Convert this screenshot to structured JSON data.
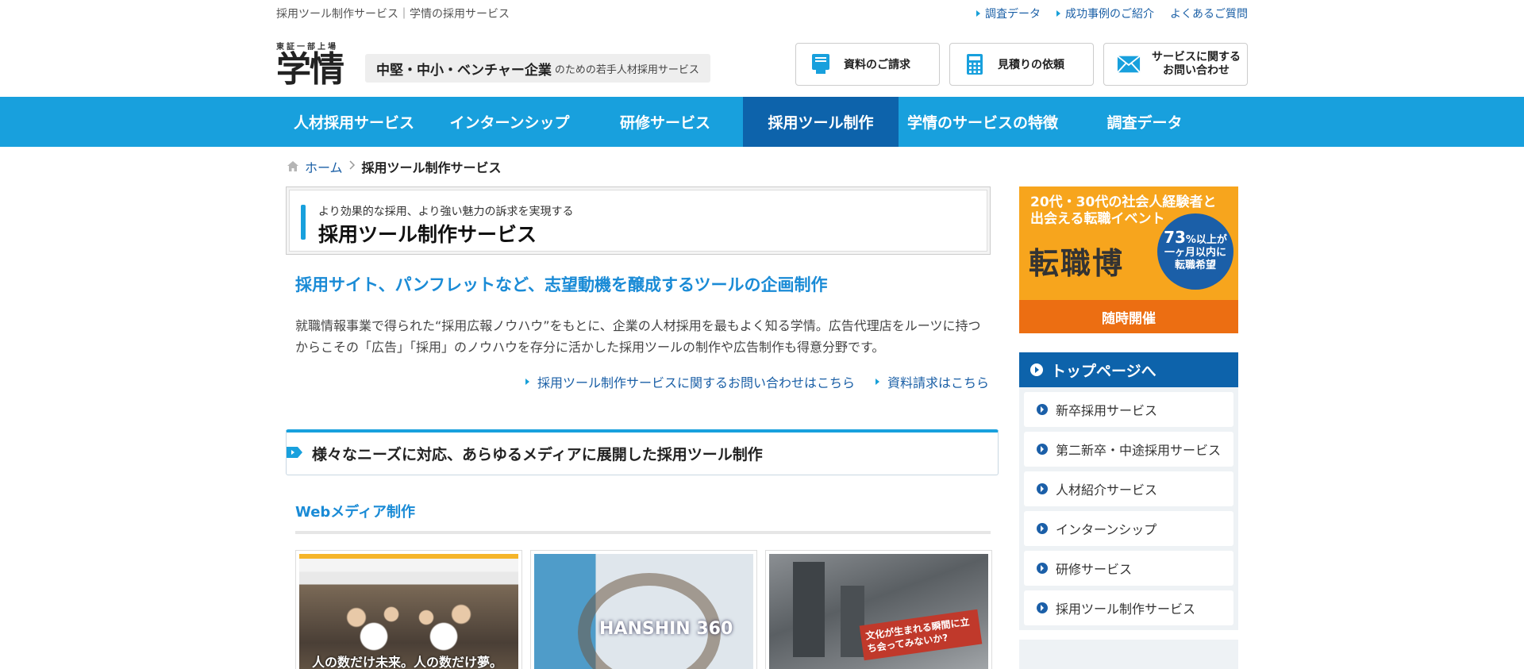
{
  "topbar": {
    "left_text": "採用ツール制作サービス｜学情の採用サービス",
    "links": [
      "調査データ",
      "成功事例のご紹介",
      "よくあるご質問"
    ]
  },
  "header": {
    "logo_small": "東証一部上場",
    "logo_main": "学情",
    "tagline_bold": "中堅・中小・ベンチャー企業",
    "tagline_small": "のための若手人材採用サービス",
    "buttons": [
      {
        "label": "資料のご請求",
        "icon": "document-icon"
      },
      {
        "label": "見積りの依頼",
        "icon": "calculator-icon"
      },
      {
        "label_line1": "サービスに関する",
        "label_line2": "お問い合わせ",
        "icon": "mail-icon"
      }
    ]
  },
  "nav": {
    "items": [
      "人材採用サービス",
      "インターンシップ",
      "研修サービス",
      "採用ツール制作",
      "学情のサービスの特徴",
      "調査データ"
    ],
    "active_index": 3
  },
  "breadcrumb": {
    "home": "ホーム",
    "current": "採用ツール制作サービス"
  },
  "main": {
    "title_sub": "より効果的な採用、より強い魅力の訴求を実現する",
    "title": "採用ツール制作サービス",
    "lead": "採用サイト、パンフレットなど、志望動機を醸成するツールの企画制作",
    "body": "就職情報事業で得られた“採用広報ノウハウ”をもとに、企業の人材採用を最もよく知る学情。広告代理店をルーツに持つからこその「広告」「採用」のノウハウを存分に活かした採用ツールの制作や広告制作も得意分野です。",
    "links": [
      "採用ツール制作サービスに関するお問い合わせはこちら",
      "資料請求はこちら"
    ],
    "section_title": "様々なニーズに対応、あらゆるメディアに展開した採用ツール制作",
    "web_heading": "Webメディア制作",
    "thumbs": [
      {
        "caption": "人の数だけ未来。人の数だけ夢。"
      },
      {
        "caption": "HANSHIN 360"
      },
      {
        "caption": "文化が生まれる瞬間に立ち会ってみないか?"
      }
    ]
  },
  "sidebar": {
    "banner": {
      "line1": "20代・30代の社会人経験者と",
      "line2": "出会える転職イベント",
      "logo": "転職博",
      "circle_big": "73",
      "circle_small": "%以上が",
      "circle_line2": "一ヶ月以内に",
      "circle_line3": "転職希望",
      "footer": "随時開催"
    },
    "menu_head": "トップページへ",
    "menu_items": [
      "新卒採用サービス",
      "第二新卒・中途採用サービス",
      "人材紹介サービス",
      "インターンシップ",
      "研修サービス",
      "採用ツール制作サービス"
    ]
  },
  "colors": {
    "nav_bg": "#18a0dd",
    "nav_active": "#0d63ab",
    "link": "#1a5fa6",
    "accent_orange": "#f7a51d"
  }
}
